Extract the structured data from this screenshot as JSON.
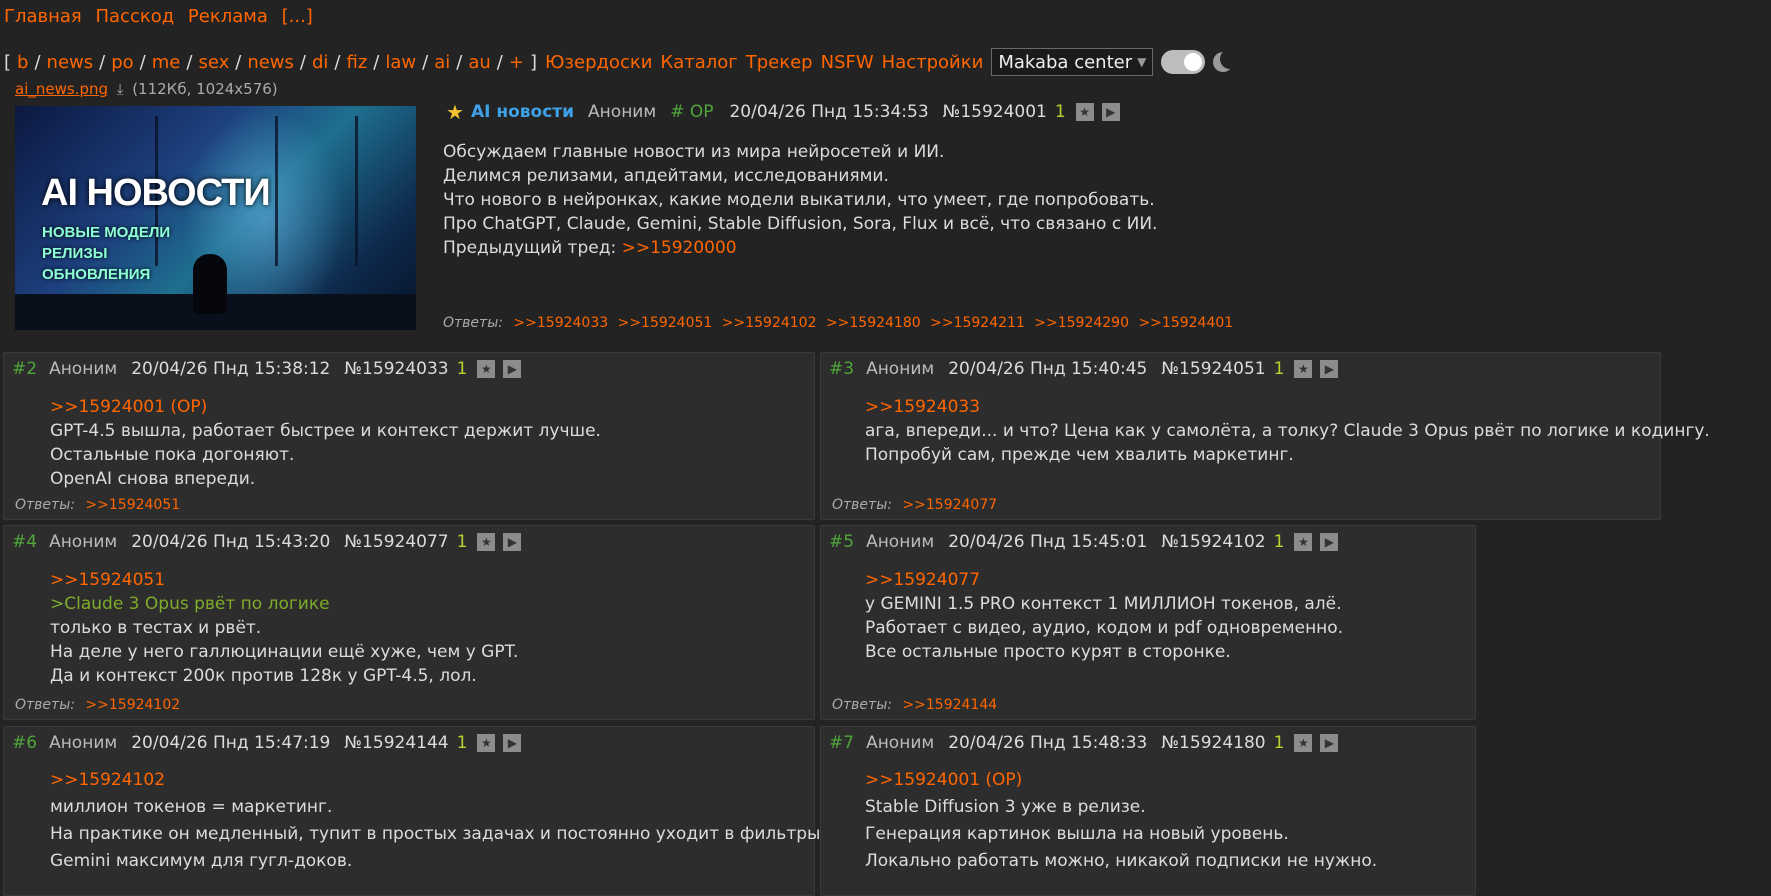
{
  "top_menu": [
    "Главная",
    "Пасскод",
    "Реклама",
    "[...]"
  ],
  "boards": [
    "b",
    "news",
    "po",
    "me",
    "sex",
    "news",
    "di",
    "fiz",
    "law",
    "ai",
    "au",
    "+"
  ],
  "nav_extra": [
    "Юзердоски",
    "Каталог",
    "Трекер",
    "NSFW",
    "Настройки"
  ],
  "style_select": {
    "value": "Makaba center"
  },
  "op": {
    "file": {
      "name": "ai_news.png",
      "meta": "(112Кб, 1024x576)"
    },
    "image_text": {
      "title": "AI НОВОСТИ",
      "lines": [
        "НОВЫЕ МОДЕЛИ",
        "РЕЛИЗЫ",
        "ОБНОВЛЕНИЯ"
      ]
    },
    "subject": "AI новости",
    "name": "Аноним",
    "tag": "# OP",
    "date": "20/04/26 Пнд 15:34:53",
    "number": "№15924001",
    "count": "1",
    "lines": [
      "Обсуждаем главные новости из мира нейросетей и ИИ.",
      "Делимся релизами, апдейтами, исследованиями.",
      "Что нового в нейронках, какие модели выкатили, что умеет, где попробовать.",
      "Про ChatGPT, Claude, Gemini, Stable Diffusion, Sora, Flux и всё, что связано с ИИ."
    ],
    "prev_label": "Предыдущий тред:",
    "prev_link": ">>15920000",
    "replies_label": "Ответы:",
    "replies": [
      ">>15924033",
      ">>15924051",
      ">>15924102",
      ">>15924180",
      ">>15924211",
      ">>15924290",
      ">>15924401"
    ]
  },
  "posts": [
    {
      "idx": "#2",
      "name": "Аноним",
      "date": "20/04/26 Пнд 15:38:12",
      "number": "№15924033",
      "count": "1",
      "reply_to": ">>15924001 (OP)",
      "quote": "",
      "lines": [
        "GPT-4.5 вышла, работает быстрее и контекст держит лучше.",
        "Остальные пока догоняют.",
        "OpenAI снова впереди."
      ],
      "replies_label": "Ответы:",
      "replies": [
        ">>15924051"
      ]
    },
    {
      "idx": "#3",
      "name": "Аноним",
      "date": "20/04/26 Пнд 15:40:45",
      "number": "№15924051",
      "count": "1",
      "reply_to": ">>15924033",
      "quote": "",
      "lines": [
        "ага, впереди... и что? Цена как у самолёта, а толку? Claude 3 Opus рвёт по логике и кодингу.",
        "Попробуй сам, прежде чем хвалить маркетинг."
      ],
      "replies_label": "Ответы:",
      "replies": [
        ">>15924077"
      ]
    },
    {
      "idx": "#4",
      "name": "Аноним",
      "date": "20/04/26 Пнд 15:43:20",
      "number": "№15924077",
      "count": "1",
      "reply_to": ">>15924051",
      "quote": ">Claude 3 Opus рвёт по логике",
      "lines": [
        "только в тестах и рвёт.",
        "На деле у него галлюцинации ещё хуже, чем у GPT.",
        "Да и контекст 200к против 128к у GPT-4.5, лол."
      ],
      "replies_label": "Ответы:",
      "replies": [
        ">>15924102"
      ]
    },
    {
      "idx": "#5",
      "name": "Аноним",
      "date": "20/04/26 Пнд 15:45:01",
      "number": "№15924102",
      "count": "1",
      "reply_to": ">>15924077",
      "quote": "",
      "lines": [
        "у GEMINI 1.5 PRO контекст 1 МИЛЛИОН токенов, алё.",
        "Работает с видео, аудио, кодом и pdf одновременно.",
        "Все остальные просто курят в сторонке."
      ],
      "replies_label": "Ответы:",
      "replies": [
        ">>15924144"
      ]
    },
    {
      "idx": "#6",
      "name": "Аноним",
      "date": "20/04/26 Пнд 15:47:19",
      "number": "№15924144",
      "count": "1",
      "reply_to": ">>15924102",
      "quote": "",
      "lines": [
        "миллион токенов = маркетинг.",
        "На практике он медленный, тупит в простых задачах и постоянно уходит в фильтры.",
        "Gemini максимум для гугл-доков."
      ],
      "replies_label": "",
      "replies": []
    },
    {
      "idx": "#7",
      "name": "Аноним",
      "date": "20/04/26 Пнд 15:48:33",
      "number": "№15924180",
      "count": "1",
      "reply_to": ">>15924001 (OP)",
      "quote": "",
      "lines": [
        "Stable Diffusion 3 уже в релизе.",
        "Генерация картинок вышла на новый уровень.",
        "Локально работать можно, никакой подписки не нужно."
      ],
      "replies_label": "",
      "replies": []
    }
  ]
}
